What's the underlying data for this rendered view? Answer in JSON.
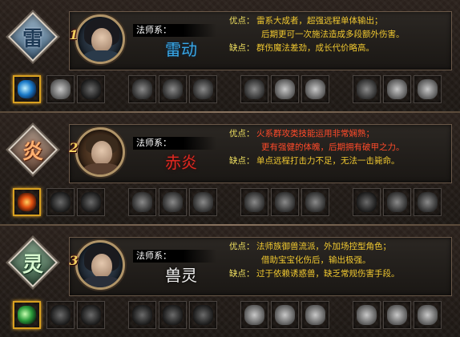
{
  "classes": [
    {
      "emblem_glyph": "雷",
      "rank": "1",
      "school_label": "法师系：",
      "class_name": "雷动",
      "pros_label": "优点：",
      "pros_line1": "雷系大成者，超强远程单体输出；",
      "pros_line2": "后期更可一次施法造成多段额外伤害。",
      "cons_label": "缺点：",
      "cons_text": "群伤魔法差劲，成长代价略高。",
      "accent_color": "#38a8e8",
      "skill_icons": [
        "lightning-active-icon",
        "lightning-bolt-icon",
        "lightning-bolt-icon",
        "storm-icon",
        "storm-icon",
        "storm-icon",
        "cloud-strike-icon",
        "cloud-strike-icon",
        "cloud-strike-icon",
        "thunder-rune-icon",
        "thunder-rune-icon",
        "thunder-rune-icon"
      ]
    },
    {
      "emblem_glyph": "炎",
      "rank": "2",
      "school_label": "法师系：",
      "class_name": "赤炎",
      "pros_label": "优点：",
      "pros_line1": "火系群攻类技能运用非常娴熟；",
      "pros_line2": "更有强健的体魄，后期拥有破甲之力。",
      "cons_label": "缺点：",
      "cons_text": "单点远程打击力不足，无法一击毙命。",
      "accent_color": "#e02820",
      "skill_icons": [
        "fire-ring-active-icon",
        "fire-ring-icon",
        "fire-ring-icon",
        "explosion-icon",
        "explosion-icon",
        "explosion-icon",
        "meteor-icon",
        "meteor-icon",
        "meteor-icon",
        "flame-icon",
        "flame-icon",
        "flame-icon"
      ]
    },
    {
      "emblem_glyph": "灵",
      "rank": "3",
      "school_label": "法师系：",
      "class_name": "兽灵",
      "pros_label": "优点：",
      "pros_line1": "法师族御兽流派，外加场控型角色；",
      "pros_line2": "借助宝宝化伤后，输出极强。",
      "cons_label": "缺点：",
      "cons_text": "过于依赖诱惑兽，缺乏常规伤害手段。",
      "accent_color": "#f0f0f0",
      "skill_icons": [
        "beast-claw-active-icon",
        "beast-claw-icon",
        "beast-claw-icon",
        "beast-head-icon",
        "beast-head-icon",
        "beast-head-icon",
        "spirit-swirl-icon",
        "spirit-swirl-icon",
        "spirit-swirl-icon",
        "vortex-icon",
        "vortex-icon",
        "vortex-icon"
      ]
    }
  ]
}
